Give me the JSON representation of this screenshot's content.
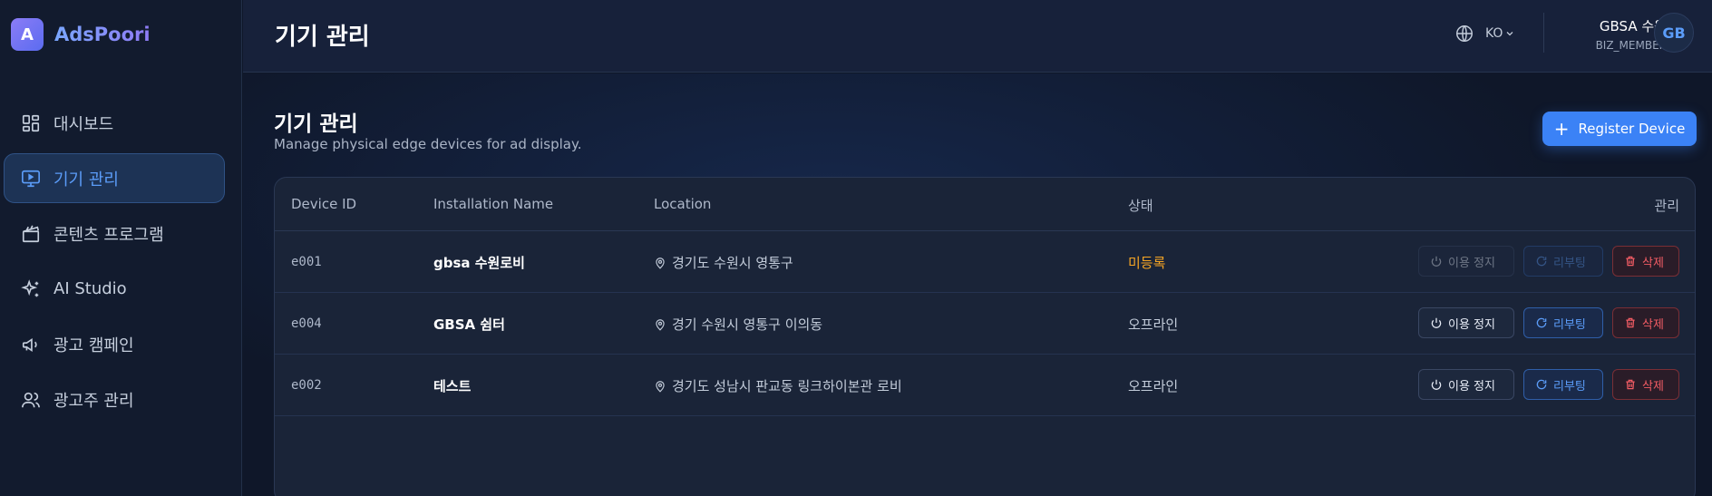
{
  "brand": {
    "logo_letter": "A",
    "name": "AdsPoori"
  },
  "sidebar": {
    "items": [
      {
        "label": "대시보드",
        "icon": "dashboard-icon",
        "active": false
      },
      {
        "label": "기기 관리",
        "icon": "monitor-play-icon",
        "active": true
      },
      {
        "label": "콘텐츠 프로그램",
        "icon": "clapperboard-icon",
        "active": false
      },
      {
        "label": "AI Studio",
        "icon": "sparkles-icon",
        "active": false
      },
      {
        "label": "광고 캠페인",
        "icon": "megaphone-icon",
        "active": false
      },
      {
        "label": "광고주 관리",
        "icon": "users-icon",
        "active": false
      }
    ]
  },
  "header": {
    "title": "기기 관리",
    "language": "KO",
    "user_name": "GBSA 수원",
    "user_role": "BIZ_MEMBER",
    "avatar": "GB"
  },
  "page": {
    "title": "기기 관리",
    "subtitle": "Manage physical edge devices for ad display.",
    "register_label": "Register Device"
  },
  "table": {
    "columns": {
      "device_id": "Device ID",
      "name": "Installation Name",
      "location": "Location",
      "status": "상태",
      "manage": "관리"
    },
    "rows": [
      {
        "device_id": "e001",
        "name": "gbsa 수원로비",
        "location": "경기도 수원시 영통구",
        "status": "미등록",
        "status_color": "#f5a524",
        "actions_enabled": false
      },
      {
        "device_id": "e004",
        "name": "GBSA 쉼터",
        "location": "경기 수원시 영통구 이의동",
        "status": "오프라인",
        "status_color": "#c3ccda",
        "actions_enabled": true
      },
      {
        "device_id": "e002",
        "name": "테스트",
        "location": "경기도 성남시 판교동 링크하이본관 로비",
        "status": "오프라인",
        "status_color": "#c3ccda",
        "actions_enabled": true
      }
    ],
    "actions": {
      "suspend": "이용 정지",
      "reboot": "리부팅",
      "delete": "삭제"
    }
  },
  "colors": {
    "accent": "#3b82f6",
    "warning": "#f5a524",
    "danger": "#f25c64"
  }
}
